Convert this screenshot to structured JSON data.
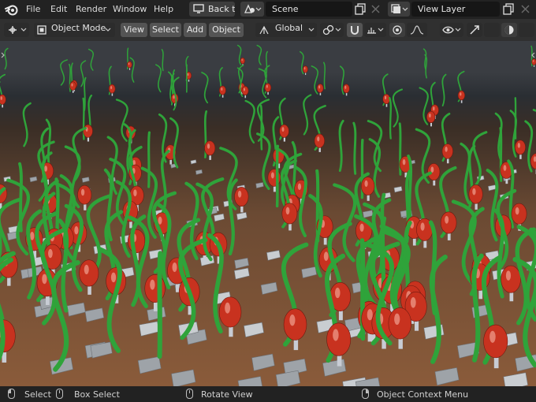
{
  "menu": [
    "File",
    "Edit",
    "Render",
    "Window",
    "Help"
  ],
  "workspace": {
    "back_label": "Back to Previous"
  },
  "scene": {
    "name": "Scene"
  },
  "view_layer": {
    "name": "View Layer"
  },
  "header": {
    "mode": "Object Mode",
    "view_menus": [
      "View",
      "Select",
      "Add",
      "Object"
    ],
    "transform_orientation": "Global"
  },
  "status": {
    "select": "Select",
    "box_select": "Box Select",
    "rotate_view": "Rotate View",
    "context_menu": "Object Context Menu"
  },
  "colors": {
    "accent": "#4772b3",
    "grass": "#2fa33a",
    "cap": "#c8321f",
    "ground": "#8a5b3a"
  }
}
